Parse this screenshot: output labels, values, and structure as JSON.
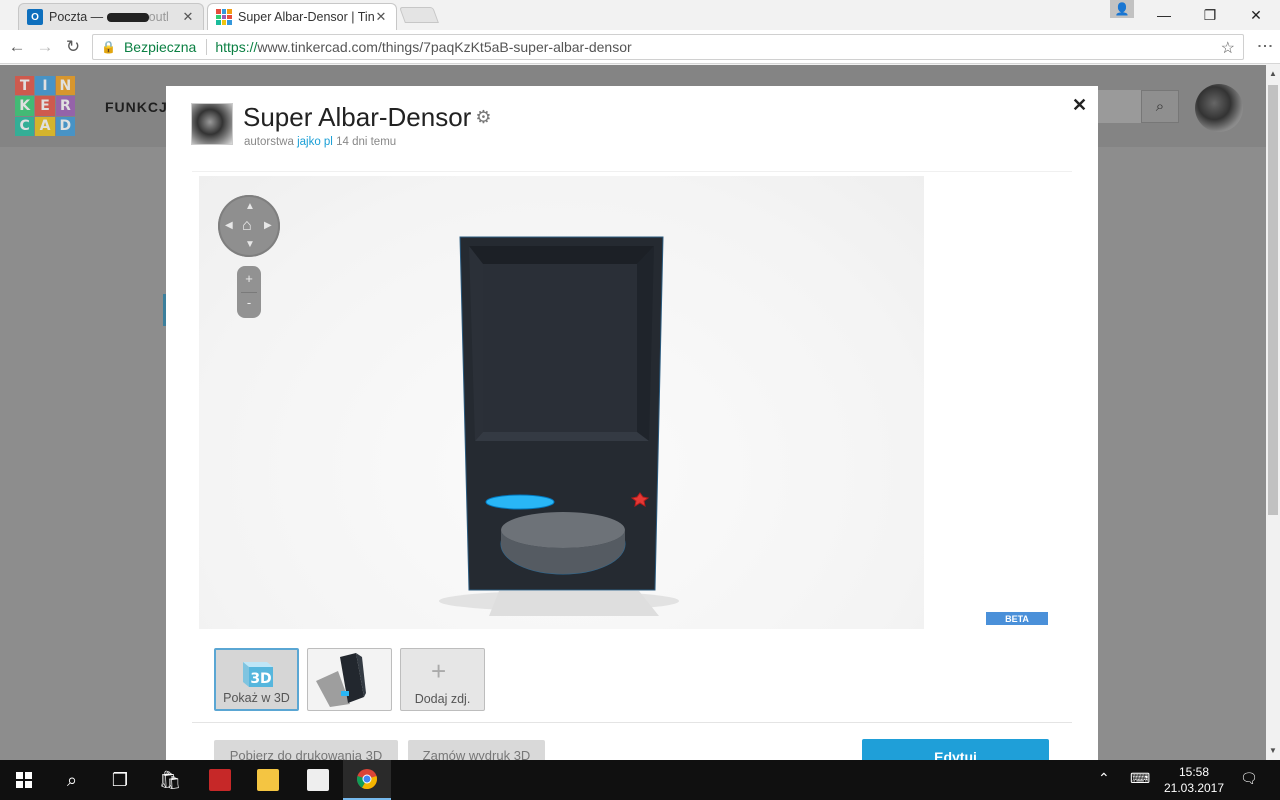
{
  "browser": {
    "tabs": [
      {
        "title": "Poczta — ",
        "suffix": "outl",
        "icon": "outlook-icon"
      },
      {
        "title": "Super Albar-Densor | Tin",
        "icon": "tinkercad-icon"
      }
    ],
    "secure_label": "Bezpieczna",
    "url_scheme": "https://",
    "url_rest": "www.tinkercad.com/things/7paqKzKt5aB-super-albar-densor"
  },
  "site": {
    "logo_letters": [
      "T",
      "I",
      "N",
      "K",
      "E",
      "R",
      "C",
      "A",
      "D"
    ],
    "logo_colors": [
      "#e74c3c",
      "#3498db",
      "#f39c12",
      "#2ecc71",
      "#e74c3c",
      "#9b59b6",
      "#1abc9c",
      "#f1c40f",
      "#3498db"
    ],
    "nav_label": "FUNKCJE"
  },
  "modal": {
    "title": "Super Albar-Densor",
    "byline_prefix": "autorstwa",
    "author": "jajko pl",
    "age": "14 dni temu",
    "beta_label": "BETA",
    "zoom_in": "+",
    "zoom_out": "-",
    "thumbnails": [
      {
        "label": "Pokaż w 3D",
        "icon": "3d-view-icon"
      },
      {
        "label": "",
        "icon": "model-thumbnail"
      },
      {
        "label": "Dodaj zdj.",
        "icon": "plus-icon"
      }
    ],
    "icon_3d_text": "3D",
    "buttons": {
      "download": "Pobierz do drukowania 3D",
      "order": "Zamów wydruk 3D",
      "edit": "Edytuj"
    }
  },
  "taskbar": {
    "time": "15:58",
    "date": "21.03.2017"
  },
  "colors": {
    "accent": "#1f9fd8",
    "model_body": "#252a31",
    "model_disc": "#29b6f6",
    "model_star": "#e53935"
  }
}
